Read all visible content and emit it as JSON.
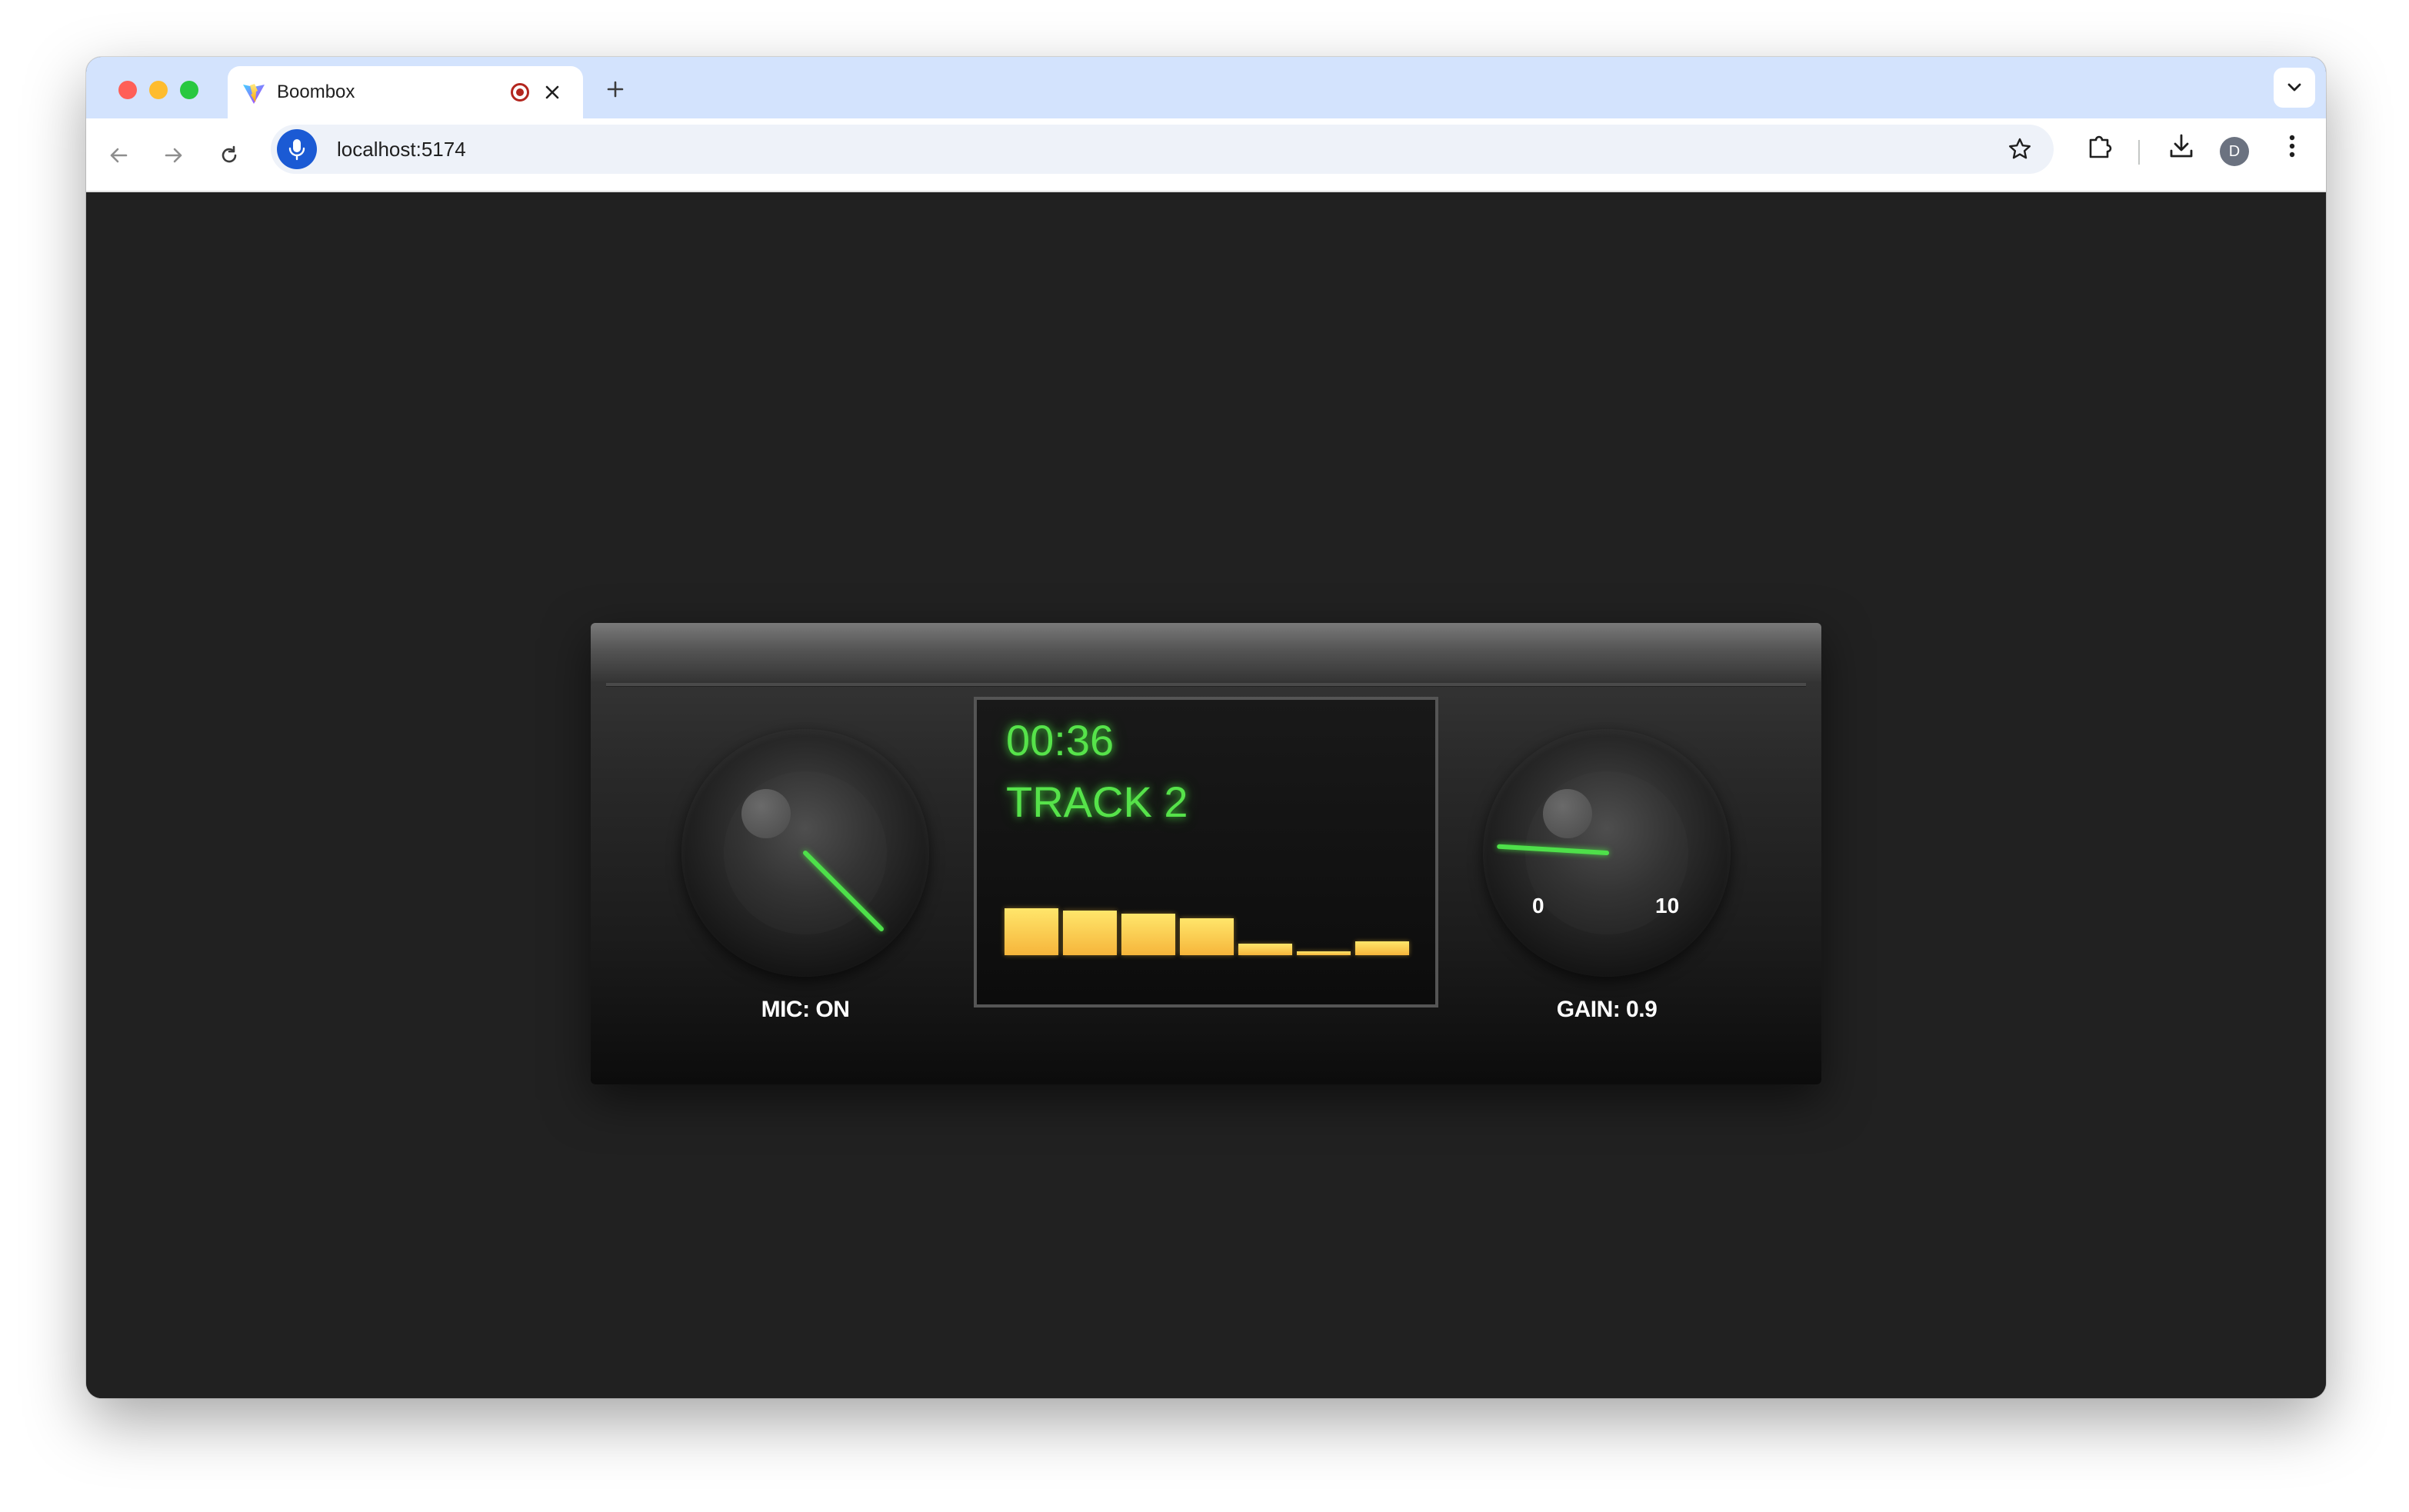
{
  "browser": {
    "tab": {
      "title": "Boombox"
    },
    "omnibox": {
      "url": "localhost:5174"
    },
    "profile_initial": "D"
  },
  "boombox": {
    "display": {
      "time": "00:36",
      "track": "TRACK 2",
      "equalizer_levels": [
        0.92,
        0.88,
        0.82,
        0.72,
        0.22,
        0.08,
        0.28
      ]
    },
    "mic_knob": {
      "label": "MIC: ON",
      "state": "on",
      "needle_angle_deg": 135
    },
    "gain_knob": {
      "label": "GAIN: 0.9",
      "value": 0.9,
      "scale_min": "0",
      "scale_max": "10"
    },
    "colors": {
      "accent_green": "#56e34a",
      "eq_yellow": "#ffe66b",
      "eq_orange": "#f6b53b",
      "page_background": "#212121"
    }
  }
}
